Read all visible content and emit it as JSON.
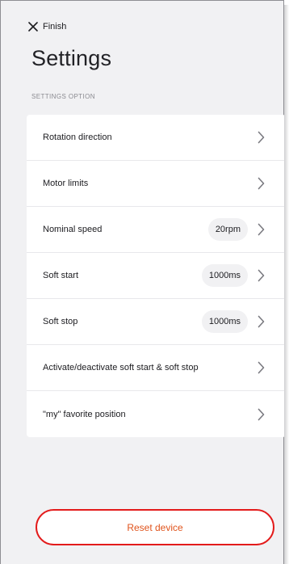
{
  "header": {
    "finish_label": "Finish",
    "title": "Settings",
    "section_label": "SETTINGS OPTION"
  },
  "settings": [
    {
      "label": "Rotation direction",
      "value": ""
    },
    {
      "label": "Motor limits",
      "value": ""
    },
    {
      "label": "Nominal speed",
      "value": "20rpm"
    },
    {
      "label": "Soft start",
      "value": "1000ms"
    },
    {
      "label": "Soft stop",
      "value": "1000ms"
    },
    {
      "label": "Activate/deactivate soft start & soft stop",
      "value": ""
    },
    {
      "label": "\"my\" favorite position",
      "value": ""
    }
  ],
  "footer": {
    "reset_label": "Reset device"
  },
  "colors": {
    "background": "#f1f1f3",
    "card": "#ffffff",
    "reset_border": "#e31b1b",
    "reset_text": "#e0531c"
  },
  "icons": {
    "close": "close-icon",
    "chevron": "chevron-right-icon"
  }
}
